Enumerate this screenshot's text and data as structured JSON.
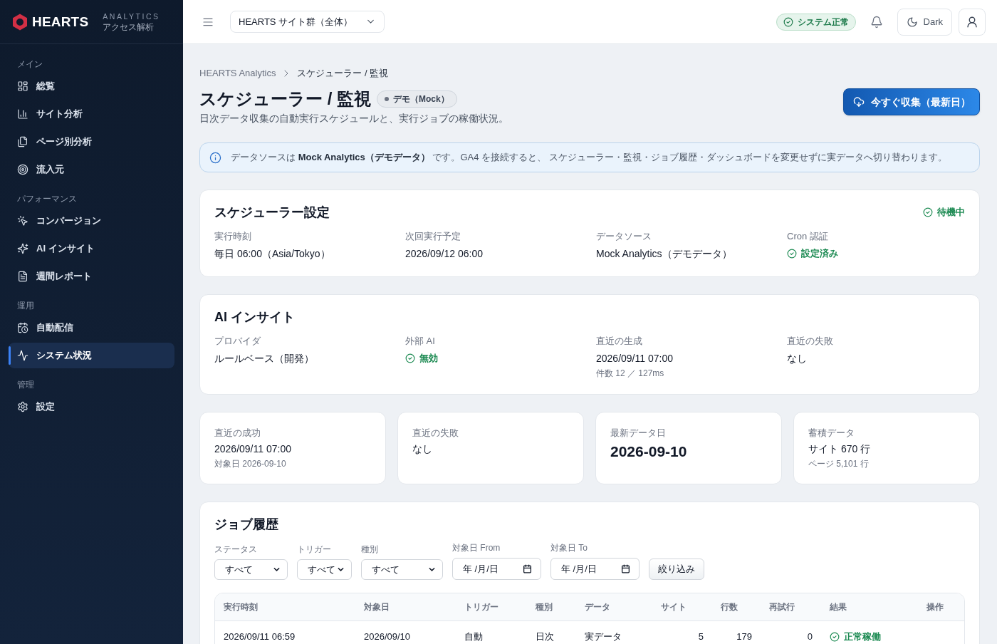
{
  "sidebar": {
    "logo": {
      "name": "HEARTS",
      "tagline": "ANALYTICS",
      "subtitle": "アクセス解析"
    },
    "sections": [
      {
        "heading": "メイン",
        "items": [
          {
            "label": "総覧",
            "selected": false
          },
          {
            "label": "サイト分析",
            "selected": false
          },
          {
            "label": "ページ別分析",
            "selected": false
          },
          {
            "label": "流入元",
            "selected": false
          }
        ]
      },
      {
        "heading": "パフォーマンス",
        "items": [
          {
            "label": "コンバージョン",
            "selected": false
          },
          {
            "label": "AI インサイト",
            "selected": false
          },
          {
            "label": "週間レポート",
            "selected": false
          }
        ]
      },
      {
        "heading": "運用",
        "items": [
          {
            "label": "自動配信",
            "selected": false
          },
          {
            "label": "システム状況",
            "selected": true
          }
        ]
      },
      {
        "heading": "管理",
        "items": [
          {
            "label": "設定",
            "selected": false
          }
        ]
      }
    ]
  },
  "topbar": {
    "site_select": {
      "value": "HEARTS サイト群（全体）"
    },
    "system_status": "システム正常",
    "theme_button": "Dark"
  },
  "page_header": {
    "breadcrumb": [
      "HEARTS Analytics",
      "スケジューラー / 監視"
    ],
    "title": "スケジューラー / 監視",
    "badge": "デモ（Mock）",
    "subtitle": "日次データ収集の自動実行スケジュールと、実行ジョブの稼働状況。",
    "action_button": "今すぐ収集（最新日）"
  },
  "info_banner": "データソースは **Mock Analytics（デモデータ）** です。GA4 を接続すると、 スケジューラー・監視・ジョブ履歴・ダッシュボードを変更せずに実データへ切り替わります。",
  "scheduler_card": {
    "title": "スケジューラー設定",
    "status": "待機中",
    "fields": [
      {
        "label": "実行時刻",
        "value": "毎日 06:00（Asia/Tokyo）",
        "kind": "text"
      },
      {
        "label": "次回実行予定",
        "value": "2026/09/12 06:00",
        "kind": "text"
      },
      {
        "label": "データソース",
        "value": "Mock Analytics（デモデータ）",
        "kind": "text"
      },
      {
        "label": "Cron 認証",
        "value": "設定済み",
        "kind": "status"
      }
    ]
  },
  "ai_card": {
    "title": "AI インサイト",
    "fields": [
      {
        "label": "プロバイダ",
        "value": "ルールベース（開発）",
        "kind": "text"
      },
      {
        "label": "外部 AI",
        "value": "無効",
        "kind": "status"
      },
      {
        "label": "直近の生成",
        "value": "2026/09/11 07:00",
        "note": "件数 12 ／ 127ms",
        "kind": "text"
      },
      {
        "label": "直近の失敗",
        "value": "なし",
        "kind": "text"
      }
    ]
  },
  "stat_cards": [
    {
      "label": "直近の成功",
      "value": "2026/09/11 07:00",
      "note": "対象日 2026-09-10",
      "kind": "text"
    },
    {
      "label": "直近の失敗",
      "value": "なし",
      "kind": "text"
    },
    {
      "label": "最新データ日",
      "value": "2026-09-10",
      "kind": "large"
    },
    {
      "label": "蓄積データ",
      "value": "サイト 670 行",
      "note": "ページ 5,101 行",
      "kind": "text"
    }
  ],
  "job_history": {
    "title": "ジョブ履歴",
    "filters": [
      {
        "label": "ステータス",
        "kind": "select",
        "value": "すべて"
      },
      {
        "label": "トリガー",
        "kind": "select",
        "value": "すべて"
      },
      {
        "label": "種別",
        "kind": "select",
        "value": "すべて"
      },
      {
        "label": "対象日 From",
        "kind": "date",
        "value": "年 /月/日"
      },
      {
        "label": "対象日 To",
        "kind": "date",
        "value": "年 /月/日"
      }
    ],
    "filter_button": "絞り込み",
    "table": {
      "columns": [
        "実行時刻",
        "対象日",
        "トリガー",
        "種別",
        "データ",
        "サイト",
        "行数",
        "再試行",
        "結果",
        "操作"
      ],
      "rows": [
        {
          "cells": [
            "2026/09/11 06:59",
            "2026/09/10",
            "自動",
            "日次",
            "実データ",
            "5",
            "179",
            "0"
          ],
          "result": "正常稼働"
        }
      ]
    }
  }
}
